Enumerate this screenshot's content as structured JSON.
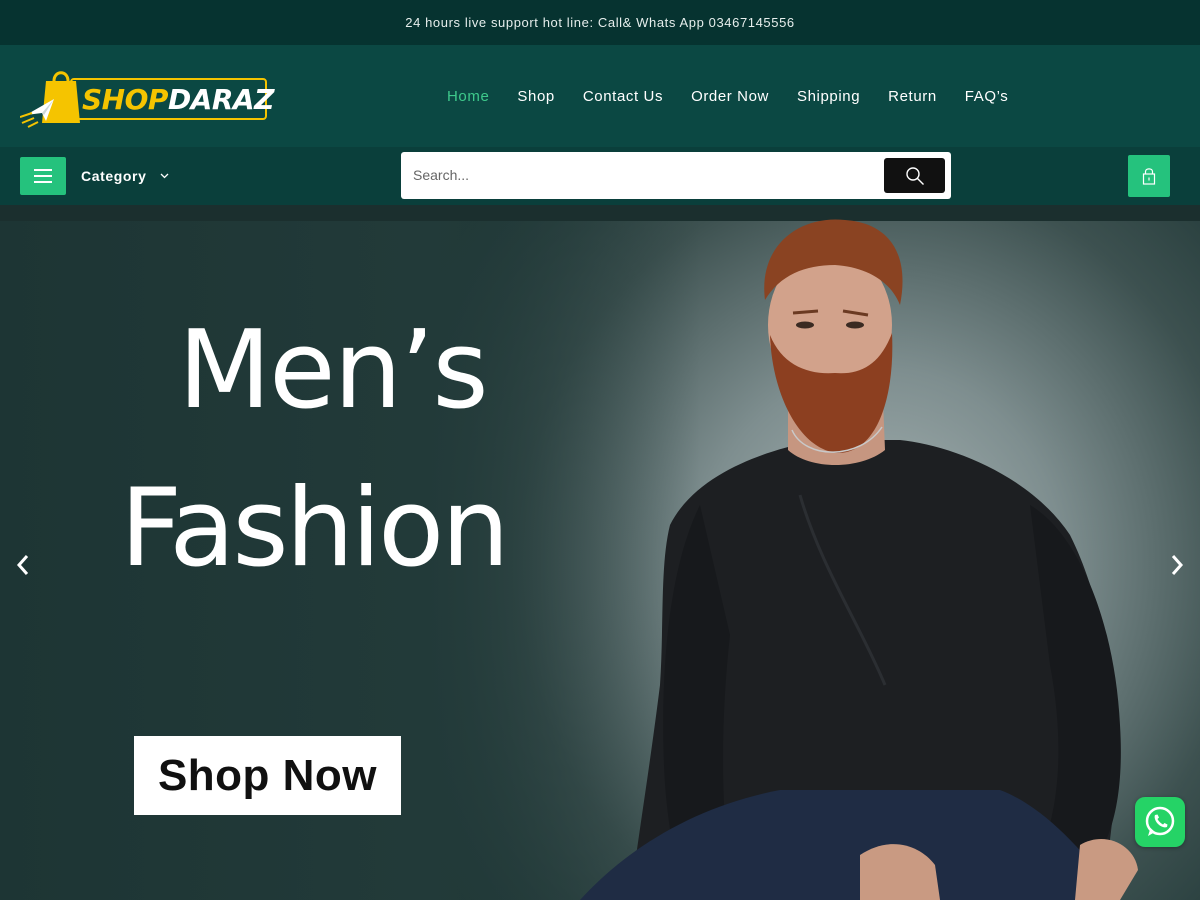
{
  "topbar": {
    "text": "24 hours live support hot line: Call& Whats App 03467145556"
  },
  "logo": {
    "part1": "SHOP",
    "part2": "DARAZ"
  },
  "nav": {
    "items": [
      {
        "label": "Home",
        "active": true
      },
      {
        "label": "Shop"
      },
      {
        "label": "Contact Us"
      },
      {
        "label": "Order Now"
      },
      {
        "label": "Shipping"
      },
      {
        "label": "Return"
      },
      {
        "label": "FAQ’s"
      }
    ]
  },
  "catbar": {
    "category_label": "Category",
    "search_placeholder": "Search..."
  },
  "hero": {
    "line1": "Men’s",
    "line2": "Fashion",
    "cta": "Shop Now"
  },
  "icons": {
    "menu": "hamburger-icon",
    "chevron": "chevron-down-icon",
    "search": "search-icon",
    "cart": "lock-bag-icon",
    "prev": "chevron-left-icon",
    "next": "chevron-right-icon",
    "whatsapp": "whatsapp-icon"
  },
  "colors": {
    "topbar": "#063330",
    "header": "#0b4843",
    "accent": "#25c27d",
    "active_nav": "#3ec98b",
    "logo_yellow": "#f5c400"
  }
}
